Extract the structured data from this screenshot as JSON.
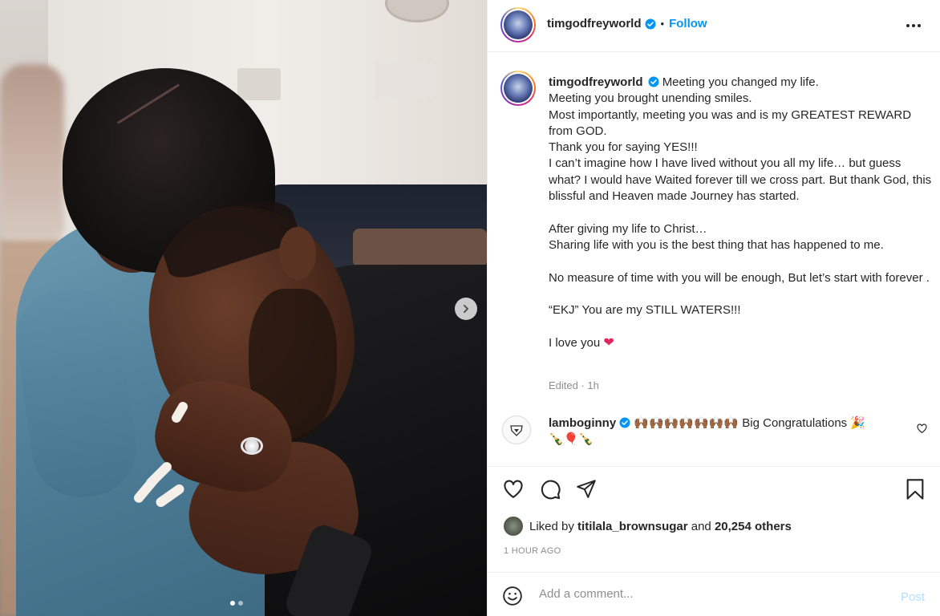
{
  "post": {
    "username": "timgodfreyworld",
    "follow_label": "Follow",
    "separator": "•"
  },
  "caption": {
    "username": "timgodfreyworld",
    "lines": [
      "Meeting you changed my life.",
      "Meeting you brought unending smiles.",
      "Most importantly, meeting you was and is my GREATEST REWARD from GOD.",
      "Thank you for saying YES!!!",
      "I can’t imagine how I have lived without you all my life… but guess what? I would have Waited forever till we cross part. But thank God, this blissful and Heaven made Journey has started.",
      "",
      "After giving my life to Christ…",
      "Sharing life with you is the best thing that has happened to me.",
      "",
      "No measure of time with you will be enough, But let’s start with forever .",
      "",
      "“EKJ” You are my STILL WATERS!!!",
      "",
      "I love you"
    ],
    "heart": "❤",
    "edited": "Edited · 1h"
  },
  "comment": {
    "username": "lamboginny",
    "emojis_prefix": "🙌🏾🙌🏾🙌🏾🙌🏾🙌🏾🙌🏾🙌🏾",
    "text": "Big Congratulations",
    "emojis_suffix": "🎉",
    "emojis_line2": "🍾🎈🍾"
  },
  "likes": {
    "prefix": "Liked by",
    "user": "titilala_brownsugar",
    "middle": "and",
    "others": "20,254 others"
  },
  "time_ago": "1 HOUR AGO",
  "comment_bar": {
    "placeholder": "Add a comment...",
    "post_label": "Post"
  },
  "carousel": {
    "total_slides": 2,
    "current_slide": 1
  },
  "colors": {
    "accent": "#0095f6",
    "verified": "#0095f6",
    "muted": "#8e8e8e",
    "post_disabled": "#b2dffc"
  }
}
